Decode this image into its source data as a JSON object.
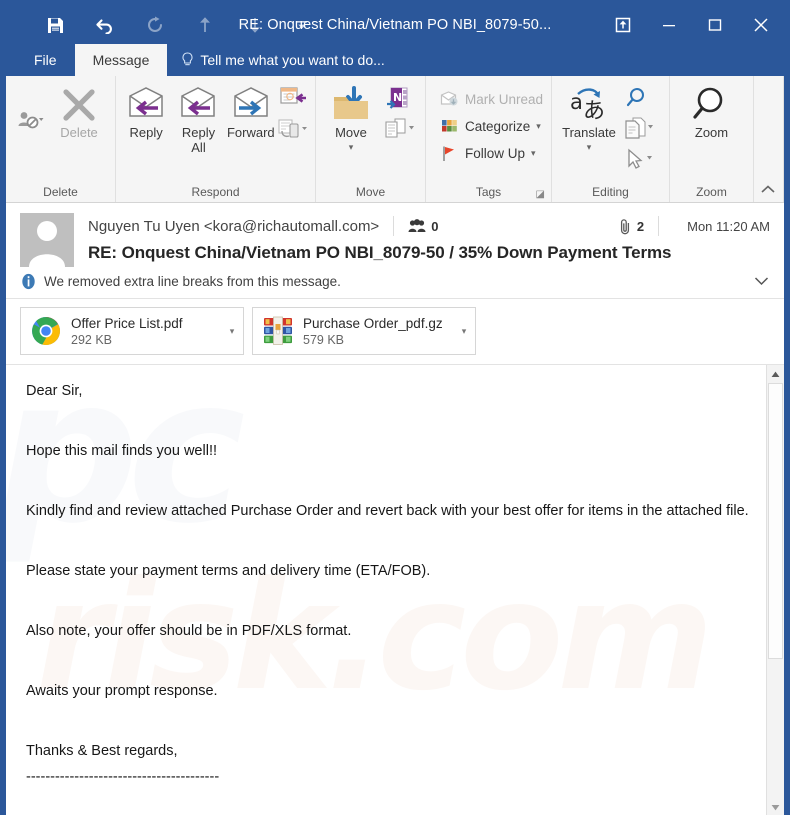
{
  "window": {
    "title": "RE: Onquest China/Vietnam PO NBI_8079-50...",
    "quick_access": [
      {
        "name": "save",
        "label": "Save",
        "icon": "save-icon",
        "enabled": true
      },
      {
        "name": "undo",
        "label": "Undo",
        "icon": "undo-icon",
        "enabled": true
      },
      {
        "name": "redo",
        "label": "Redo",
        "icon": "redo-icon",
        "enabled": false
      },
      {
        "name": "previous-item",
        "label": "Previous Item",
        "icon": "arrow-up-icon",
        "enabled": false
      },
      {
        "name": "next-item",
        "label": "Next Item",
        "icon": "arrow-down-icon",
        "enabled": false
      },
      {
        "name": "customize",
        "label": "Customize Quick Access Toolbar",
        "icon": "chevron-down-icon",
        "enabled": true
      }
    ],
    "controls": [
      {
        "name": "popout",
        "label": "Pop Out",
        "icon": "popout-icon"
      },
      {
        "name": "minimize",
        "label": "Minimize",
        "icon": "minimize-icon"
      },
      {
        "name": "maximize",
        "label": "Maximize",
        "icon": "maximize-icon"
      },
      {
        "name": "close",
        "label": "Close",
        "icon": "close-icon"
      }
    ]
  },
  "tabs": {
    "file": "File",
    "message": "Message",
    "tell_me": "Tell me what you want to do..."
  },
  "ribbon": {
    "collapse_label": "⌃",
    "groups": [
      {
        "name": "delete",
        "label": "Delete",
        "items": [
          {
            "name": "ignore",
            "label": "",
            "icon": "ignore-icon",
            "disabled": false,
            "has_dropdown": true
          },
          {
            "name": "delete",
            "label": "Delete",
            "icon": "delete-x-icon",
            "disabled": true
          }
        ]
      },
      {
        "name": "respond",
        "label": "Respond",
        "items": [
          {
            "name": "reply",
            "label": "Reply",
            "icon": "reply-icon"
          },
          {
            "name": "reply-all",
            "label": "Reply\nAll",
            "label_line1": "Reply",
            "label_line2": "All",
            "icon": "reply-all-icon"
          },
          {
            "name": "forward",
            "label": "Forward",
            "icon": "forward-icon"
          },
          {
            "name": "meeting",
            "label": "",
            "icon": "meeting-icon"
          },
          {
            "name": "more-respond",
            "label": "",
            "icon": "more-respond-icon",
            "has_dropdown": true
          }
        ]
      },
      {
        "name": "move",
        "label": "Move",
        "items": [
          {
            "name": "move",
            "label": "Move",
            "icon": "move-folder-icon",
            "has_dropdown": true
          },
          {
            "name": "onenote",
            "label": "",
            "icon": "onenote-icon"
          },
          {
            "name": "rules",
            "label": "",
            "icon": "rules-icon",
            "has_dropdown": true
          }
        ]
      },
      {
        "name": "tags",
        "label": "Tags",
        "dialog_launcher": "⤵",
        "items": [
          {
            "name": "mark-unread",
            "label": "Mark Unread",
            "icon": "mark-unread-icon",
            "disabled": true
          },
          {
            "name": "categorize",
            "label": "Categorize",
            "icon": "categorize-icon",
            "has_dropdown": true
          },
          {
            "name": "follow-up",
            "label": "Follow Up",
            "icon": "follow-up-flag-icon",
            "has_dropdown": true
          }
        ]
      },
      {
        "name": "editing",
        "label": "Editing",
        "items": [
          {
            "name": "translate",
            "label": "Translate",
            "icon": "translate-icon",
            "has_dropdown": true
          },
          {
            "name": "find",
            "label": "",
            "icon": "find-magnifier-icon"
          },
          {
            "name": "related",
            "label": "",
            "icon": "related-document-icon",
            "has_dropdown": true
          },
          {
            "name": "select",
            "label": "",
            "icon": "select-cursor-icon",
            "has_dropdown": true
          }
        ]
      },
      {
        "name": "zoom",
        "label": "Zoom",
        "items": [
          {
            "name": "zoom",
            "label": "Zoom",
            "icon": "zoom-magnifier-icon"
          }
        ]
      }
    ]
  },
  "message": {
    "sender": "Nguyen Tu Uyen <kora@richautomall.com>",
    "recipients_count": "0",
    "attachment_count": "2",
    "datetime": "Mon 11:20 AM",
    "subject": "RE: Onquest China/Vietnam PO NBI_8079-50 / 35% Down Payment Terms",
    "info_bar": "We removed extra line breaks from this message.",
    "attachments": [
      {
        "name": "Offer Price List.pdf",
        "size": "292 KB",
        "icon": "chrome-pdf-icon"
      },
      {
        "name": "Purchase Order_pdf.gz",
        "size": "579 KB",
        "icon": "winrar-archive-icon"
      }
    ],
    "body": {
      "line1": "Dear Sir,",
      "line2": "Hope this mail finds you well!!",
      "line3": "Kindly find and review attached Purchase Order and revert back with your best offer for items in the attached file.",
      "line4": "Please state your payment terms and delivery time (ETA/FOB).",
      "line5": "Also note, your offer should be in PDF/XLS format.",
      "line6": "Awaits your prompt response.",
      "line7": "Thanks & Best regards,",
      "line8": "----------------------------------------"
    },
    "watermark_a": "pc",
    "watermark_b": "risk.com"
  },
  "colors": {
    "title_bar": "#2b579a",
    "ribbon_bg": "#f5f5f5",
    "accent_purple": "#7b2f8f",
    "accent_blue": "#2e75b6",
    "flag_red": "#e8452a"
  }
}
